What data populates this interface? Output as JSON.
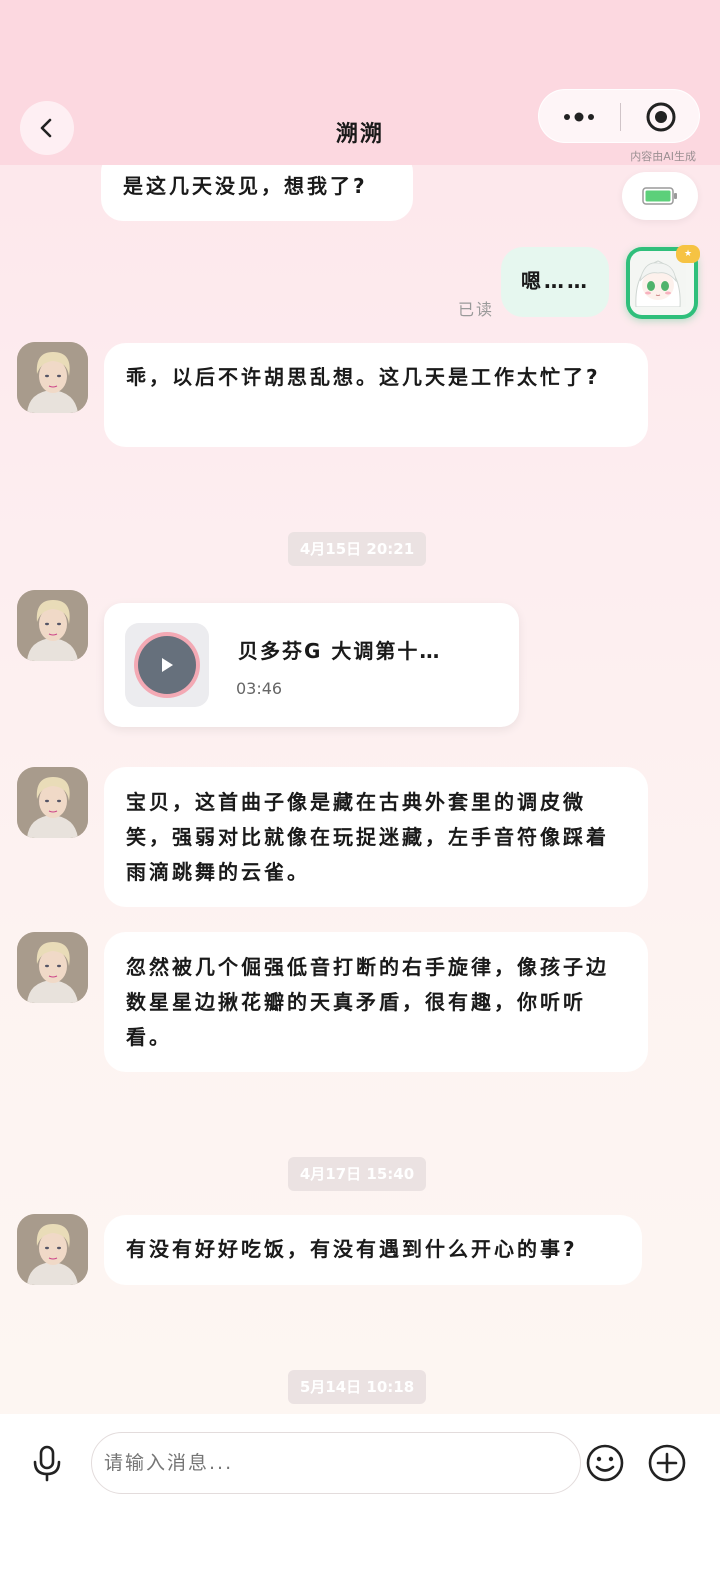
{
  "header": {
    "title": "溯溯",
    "ai_notice": "内容由AI生成"
  },
  "messages": {
    "m1": "是这几天没见，想我了?",
    "m2": "嗯……",
    "read_status": "已读",
    "m3": "乖，以后不许胡思乱想。这几天是工作太忙了?",
    "ts1": "4月15日  20:21",
    "music": {
      "title": "贝多芬G 大调第十…",
      "duration": "03:46"
    },
    "m4": "宝贝，这首曲子像是藏在古典外套里的调皮微笑，强弱对比就像在玩捉迷藏，左手音符像踩着雨滴跳舞的云雀。",
    "m5": "忽然被几个倔强低音打断的右手旋律，像孩子边数星星边揪花瓣的天真矛盾，很有趣，你听听看。",
    "ts2": "4月17日  15:40",
    "m6": "有没有好好吃饭，有没有遇到什么开心的事?",
    "ts3": "5月14日  10:18"
  },
  "input": {
    "placeholder": "请输入消息..."
  },
  "colors": {
    "header_bg": "#fcd8e0",
    "my_bubble": "#e6f7ef",
    "battery_green": "#5cd07a",
    "user_avatar_border": "#2fbf7b"
  },
  "icons": {
    "back": "chevron-left-icon",
    "more": "more-dots-icon",
    "target": "target-icon",
    "battery": "battery-icon",
    "mic": "microphone-icon",
    "emoji": "emoji-icon",
    "plus": "plus-icon",
    "play": "play-icon"
  }
}
